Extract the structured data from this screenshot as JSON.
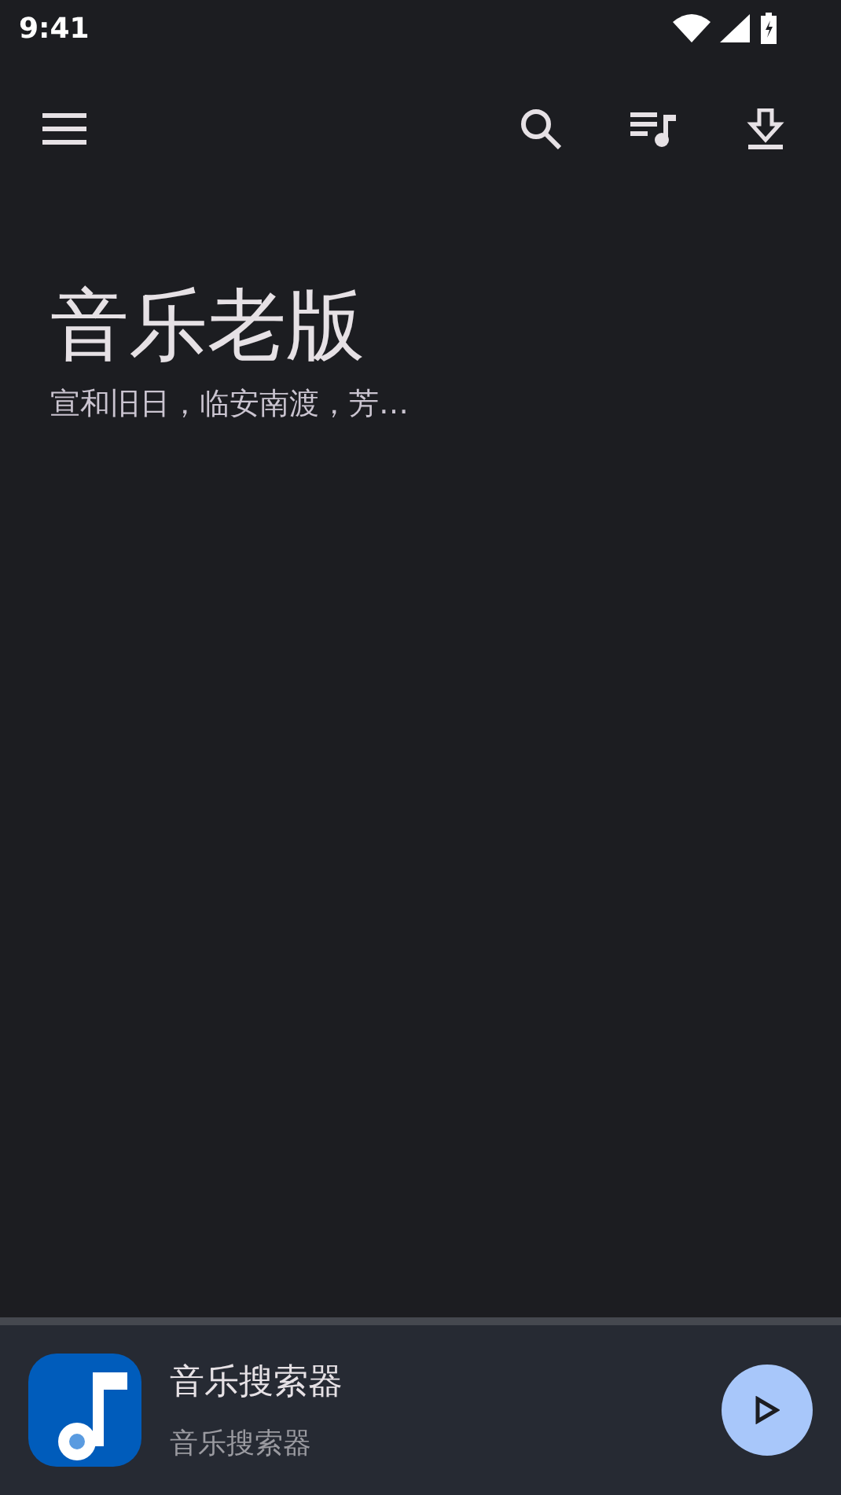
{
  "status_bar": {
    "time": "9:41"
  },
  "header": {
    "title": "音乐老版",
    "subtitle": "宣和旧日，临安南渡，芳…"
  },
  "player": {
    "title": "音乐搜索器",
    "subtitle": "音乐搜索器"
  }
}
